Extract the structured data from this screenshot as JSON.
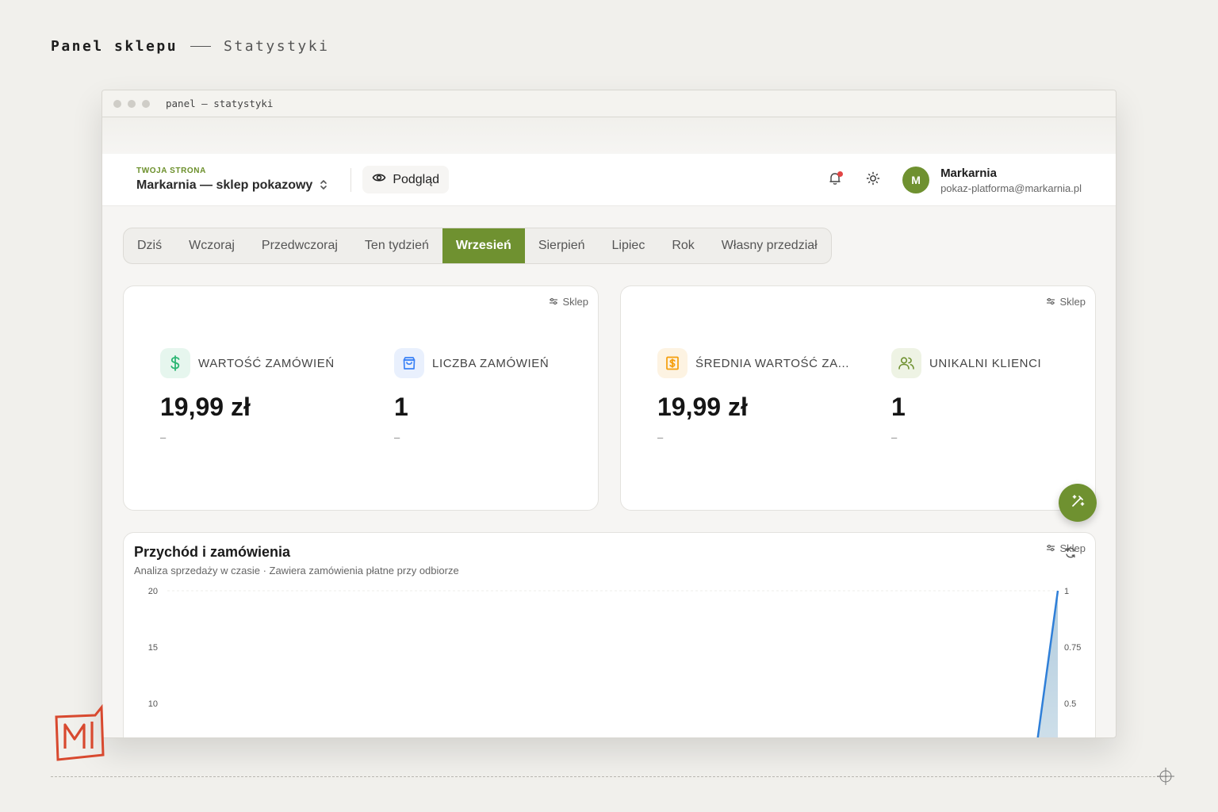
{
  "caption": {
    "title": "Panel sklepu",
    "subtitle": "Statystyki"
  },
  "window": {
    "title": "panel — statystyki"
  },
  "header": {
    "site_label": "TWOJA STRONA",
    "site_name": "Markarnia — sklep pokazowy",
    "preview_label": "Podgląd",
    "user_initial": "M",
    "user_name": "Markarnia",
    "user_email": "pokaz-platforma@markarnia.pl"
  },
  "tabs": [
    "Dziś",
    "Wczoraj",
    "Przedwczoraj",
    "Ten tydzień",
    "Wrzesień",
    "Sierpień",
    "Lipiec",
    "Rok",
    "Własny przedział"
  ],
  "active_tab": "Wrzesień",
  "cards": {
    "tag": "Sklep",
    "stats": [
      {
        "label": "WARTOŚĆ ZAMÓWIEŃ",
        "value": "19,99 zł",
        "delta": "–",
        "icon": "dollar-icon",
        "color": "#2bb673"
      },
      {
        "label": "LICZBA ZAMÓWIEŃ",
        "value": "1",
        "delta": "–",
        "icon": "shopping-bag-icon",
        "color": "#3b82f6"
      },
      {
        "label": "ŚREDNIA WARTOŚĆ ZA...",
        "value": "19,99 zł",
        "delta": "–",
        "icon": "receipt-icon",
        "color": "#f59e0b"
      },
      {
        "label": "UNIKALNI KLIENCI",
        "value": "1",
        "delta": "–",
        "icon": "users-icon",
        "color": "#6f9130"
      }
    ]
  },
  "chart_card": {
    "title": "Przychód i zamówienia",
    "subtitle": "Analiza sprzedaży w czasie · Zawiera zamówienia płatne przy odbiorze",
    "tag": "Sklep"
  },
  "chart_data": {
    "type": "area",
    "title": "Przychód i zamówienia",
    "y_left_ticks": [
      "20",
      "15",
      "10"
    ],
    "y_right_ticks": [
      "1",
      "0.75",
      "0.5"
    ],
    "y_left_range": [
      0,
      20
    ],
    "y_right_range": [
      0,
      1
    ],
    "series": [
      {
        "axis": "right",
        "color": "#2f7fd8",
        "x": [
          29,
          30
        ],
        "values": [
          0,
          1
        ]
      }
    ],
    "x_range": [
      1,
      30
    ],
    "grid": true
  },
  "colors": {
    "accent": "#6f9130",
    "badge": "#e24545"
  }
}
